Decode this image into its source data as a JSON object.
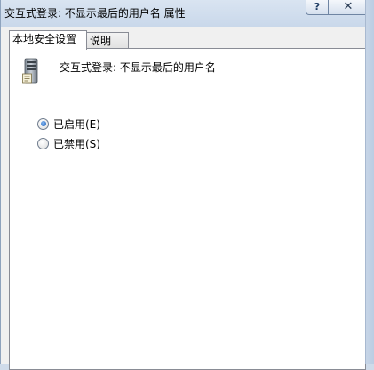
{
  "window": {
    "title": "交互式登录: 不显示最后的用户名 属性",
    "help_label": "?",
    "close_label": "✕"
  },
  "tabs": [
    {
      "label": "本地安全设置",
      "active": true
    },
    {
      "label": "说明",
      "active": false
    }
  ],
  "policy": {
    "icon": "server-icon",
    "name": "交互式登录: 不显示最后的用户名"
  },
  "options": [
    {
      "label": "已启用(E)",
      "checked": true
    },
    {
      "label": "已禁用(S)",
      "checked": false
    }
  ]
}
